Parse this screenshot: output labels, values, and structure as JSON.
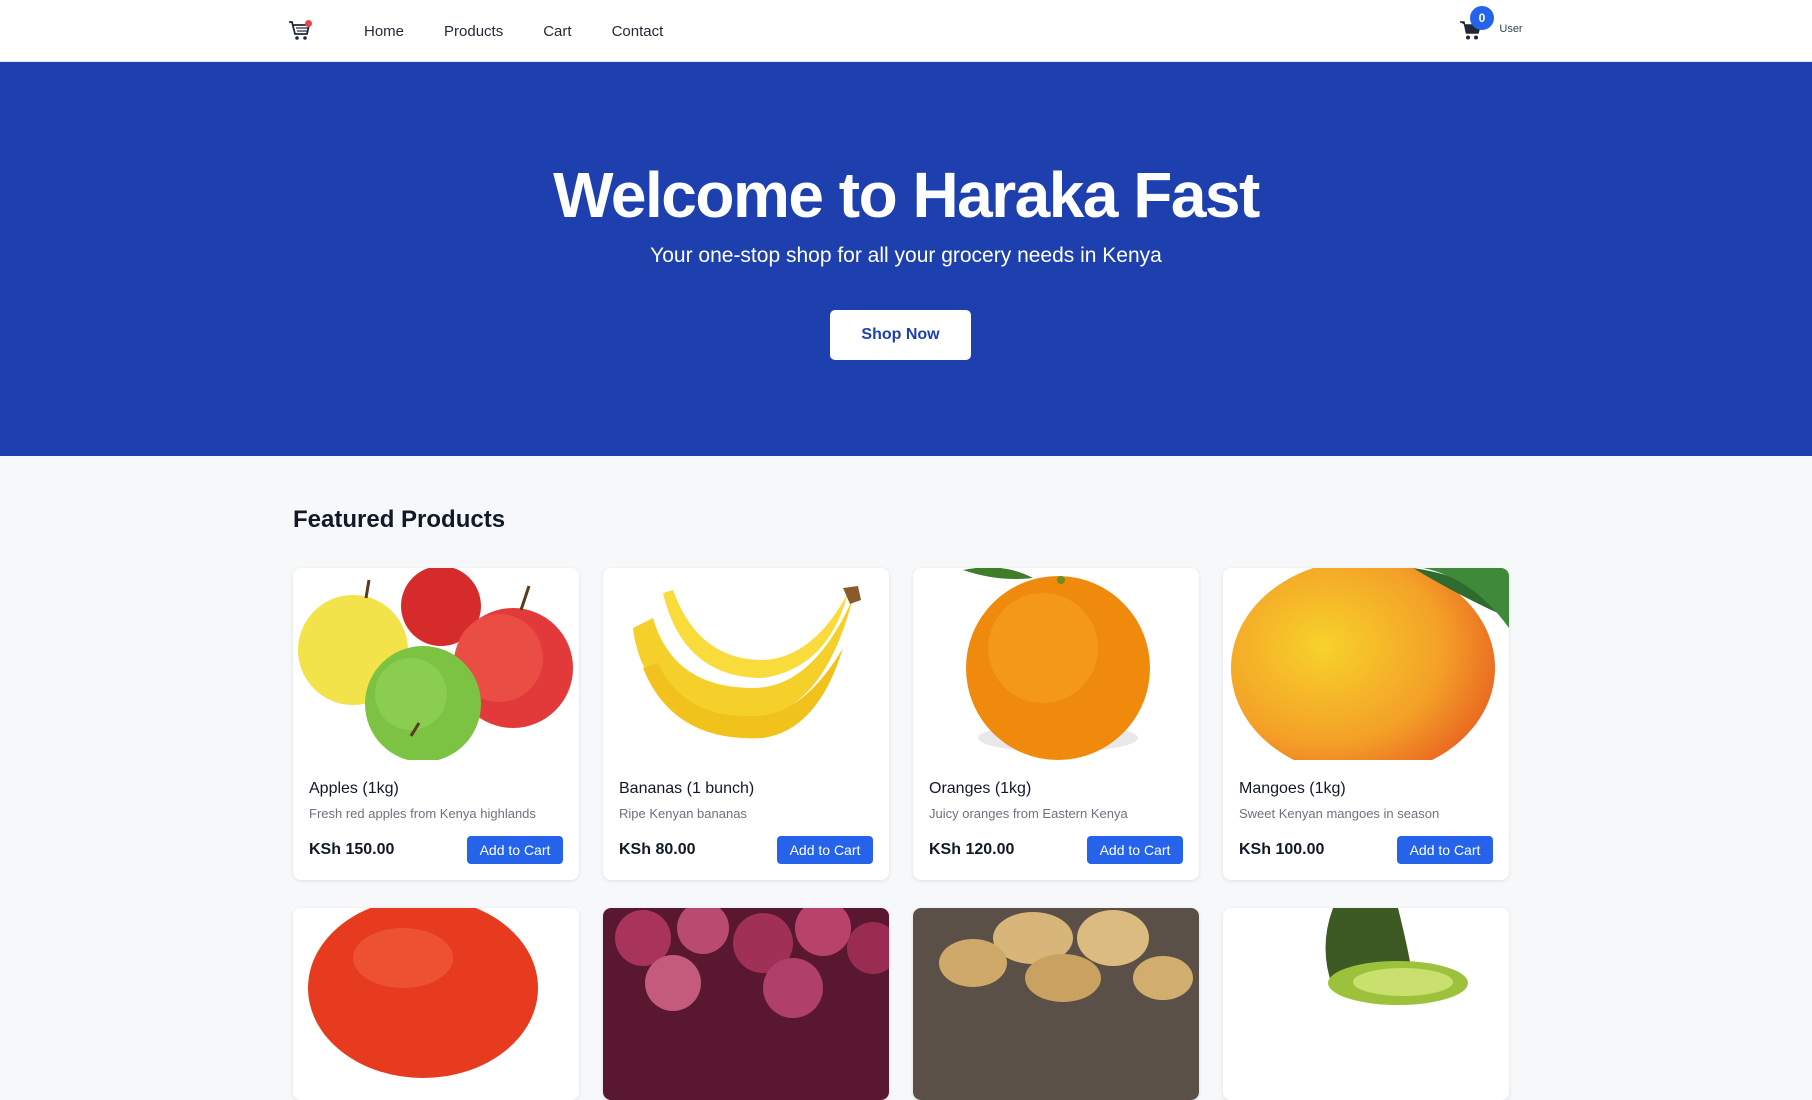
{
  "nav": {
    "links": [
      "Home",
      "Products",
      "Cart",
      "Contact"
    ],
    "cart_count": "0",
    "avatar_alt": "User"
  },
  "hero": {
    "title": "Welcome to Haraka Fast",
    "subtitle": "Your one-stop shop for all your grocery needs in Kenya",
    "cta": "Shop Now"
  },
  "featured": {
    "title": "Featured Products",
    "products": [
      {
        "name": "Apples (1kg)",
        "description": "Fresh red apples from Kenya highlands",
        "price": "KSh 150.00",
        "button": "Add to Cart"
      },
      {
        "name": "Bananas (1 bunch)",
        "description": "Ripe Kenyan bananas",
        "price": "KSh 80.00",
        "button": "Add to Cart"
      },
      {
        "name": "Oranges (1kg)",
        "description": "Juicy oranges from Eastern Kenya",
        "price": "KSh 120.00",
        "button": "Add to Cart"
      },
      {
        "name": "Mangoes (1kg)",
        "description": "Sweet Kenyan mangoes in season",
        "price": "KSh 100.00",
        "button": "Add to Cart"
      }
    ]
  },
  "colors": {
    "hero_bg": "#1e40af",
    "accent": "#2563eb",
    "badge": "#ef4444"
  }
}
